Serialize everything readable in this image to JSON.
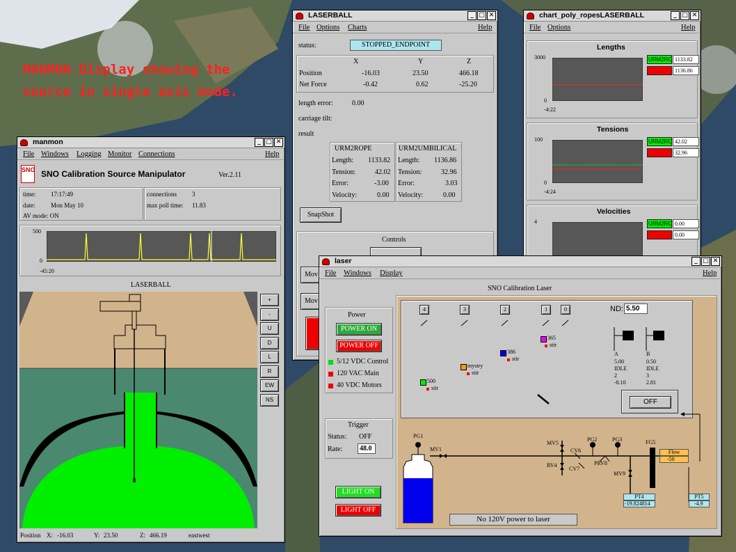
{
  "caption": "MANMON Display showing the source in single axis mode.",
  "colors": {
    "accent_green": "#00ee00",
    "alarm_red": "#ee0000",
    "panel": "#c9c9c9",
    "pool": "#4b8870",
    "deck": "#d2b48c",
    "plot": "#575757"
  },
  "manmon": {
    "title": "manmon",
    "menu": {
      "file": "File",
      "windows": "Windows",
      "logging": "Logging",
      "monitor": "Monitor",
      "connections": "Connections",
      "help": "Help"
    },
    "logo": "SNO",
    "app_title": "SNO Calibration Source Manipulator",
    "version": "Ver.2.11",
    "time_label": "time:",
    "time": "17:17:49",
    "date_label": "date:",
    "date": "Mon May 10",
    "av_mode": "AV mode: ON",
    "connections_label": "connections",
    "connections": "3",
    "poll_label": "max poll time:",
    "poll": "11.83",
    "chart": {
      "ymax": "500",
      "ymin": "0",
      "xstart": "-45:20"
    },
    "view_title": "LASERBALL",
    "side_buttons": [
      "+",
      "-",
      "U",
      "D",
      "L",
      "R",
      "EW",
      "NS"
    ],
    "status": {
      "position": "Position",
      "x_label": "X:",
      "x": "-16.03",
      "y_label": "Y:",
      "y": "23.50",
      "z_label": "Z:",
      "z": "466.19",
      "mode": "eastwest"
    }
  },
  "laserball": {
    "title": "LASERBALL",
    "menu": {
      "file": "File",
      "options": "Options",
      "charts": "Charts",
      "help": "Help"
    },
    "status_label": "status:",
    "status": "STOPPED_ENDPOINT",
    "cols": [
      "X",
      "Y",
      "Z"
    ],
    "position_label": "Position",
    "position": [
      "-16.03",
      "23.50",
      "466.18"
    ],
    "force_label": "Net Force",
    "force": [
      "-0.42",
      "0.62",
      "-25.20"
    ],
    "length_error_label": "length error:",
    "length_error": "0.00",
    "carriage_tilt_label": "carriage tilt:",
    "result_label": "result",
    "ropes": [
      {
        "name": "URM2ROPE",
        "length": "1133.82",
        "tension": "42.02",
        "error": "-3.00",
        "velocity": "0.00"
      },
      {
        "name": "URM2UMBILICAL",
        "length": "1136.86",
        "tension": "32.96",
        "error": "3.03",
        "velocity": "0.00"
      }
    ],
    "rope_labels": {
      "length": "Length:",
      "tension": "Tension:",
      "error": "Error:",
      "velocity": "Velocity:"
    },
    "snapshot": "SnapShot",
    "controls": "Controls",
    "move_prefix": "Mov"
  },
  "chart_window": {
    "title": "chart_poly_ropesLASERBALL",
    "menu": {
      "file": "File",
      "options": "Options",
      "help": "Help"
    },
    "legend_name": "URM2RO"
  },
  "chart_data": [
    {
      "type": "line",
      "title": "Lengths",
      "ylim": [
        0,
        3000
      ],
      "y_ticks": [
        "3000",
        "0"
      ],
      "x_start": "-4:22",
      "series": [
        {
          "name": "URM2RO",
          "values": [
            1133.82,
            1133.82
          ]
        },
        {
          "values": [
            1136.86,
            1136.86
          ]
        }
      ],
      "readouts": [
        "1133.82",
        "1136.86"
      ]
    },
    {
      "type": "line",
      "title": "Tensions",
      "ylim": [
        0,
        100
      ],
      "y_ticks": [
        "100",
        "0"
      ],
      "x_start": "-4:24",
      "series": [
        {
          "name": "URM2RO",
          "values": [
            42.02,
            42.02
          ]
        },
        {
          "values": [
            32.96,
            32.96
          ]
        }
      ],
      "readouts": [
        "42.02",
        "32.96"
      ]
    },
    {
      "type": "line",
      "title": "Velocities",
      "ylim": [
        0,
        4
      ],
      "y_ticks": [
        "4"
      ],
      "x_start": "",
      "series": [
        {
          "name": "URM2RO",
          "values": [
            0,
            0
          ]
        },
        {
          "values": [
            0,
            0
          ]
        }
      ],
      "readouts": [
        "0.00",
        "0.00"
      ]
    }
  ],
  "laser": {
    "title": "laser",
    "menu": {
      "file": "File",
      "windows": "Windows",
      "display": "Display",
      "help": "Help"
    },
    "app_title": "SNO Calibration Laser",
    "power_label": "Power",
    "power_on": "POWER ON",
    "power_off": "POWER OFF",
    "indicators": [
      "5/12 VDC Control",
      "120 VAC Main",
      "40 VDC Motors"
    ],
    "trigger_label": "Trigger",
    "trigger_status_label": "Status:",
    "trigger_status": "OFF",
    "rate_label": "Rate:",
    "rate": "48.0",
    "light_on": "LIGHT ON",
    "light_off": "LIGHT OFF",
    "filters": [
      "4",
      "3",
      "2",
      "1",
      "0"
    ],
    "nd_label": "ND:",
    "nd": "5.50",
    "dyes": [
      {
        "name": "365",
        "stir": "stir"
      },
      {
        "name": "386",
        "stir": "stir"
      },
      {
        "name": "mystry",
        "stir": "stir"
      },
      {
        "name": "500",
        "stir": "stir"
      }
    ],
    "shutter_a": {
      "label": "A",
      "v1": "5.00",
      "v2": "IDLE",
      "v3": "2",
      "v4": "-8.10"
    },
    "shutter_b": {
      "label": "B",
      "v1": "0.50",
      "v2": "IDLE",
      "v3": "3",
      "v4": "2.81"
    },
    "off_button": "OFF",
    "gas": {
      "pg1": "PG1",
      "mv1": "MV1",
      "mv5": "MV5",
      "rv4": "RV4",
      "cv6": "CV6",
      "cv7": "CV7",
      "pg2": "PG2",
      "prv8": "PRV8",
      "pg3": "PG3",
      "mv9": "MV9",
      "fg5": "FG5",
      "flow_label": "Flow",
      "flow": "-50",
      "pt4": "PT4",
      "pt4_value": "-19.824814",
      "pt5": "PT5",
      "pt5_value": "-4.9"
    },
    "warning": "No 120V power to laser"
  }
}
